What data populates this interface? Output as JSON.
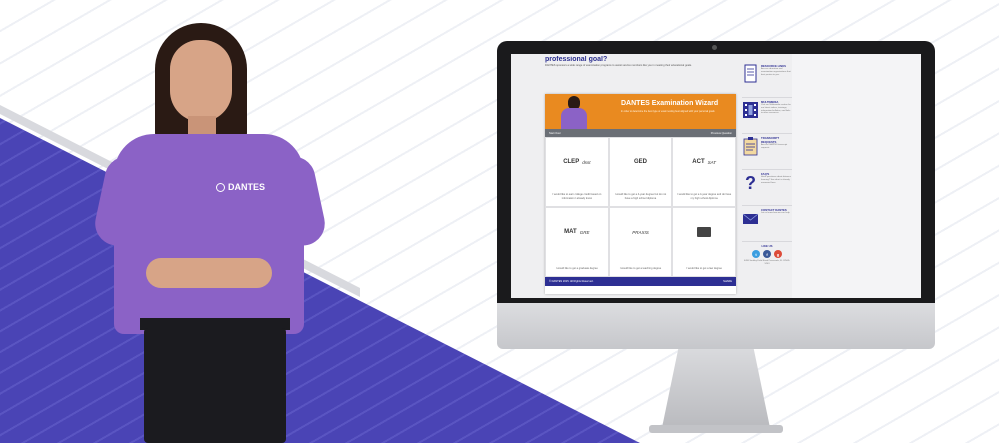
{
  "brand": {
    "shirt_logo": "DANTES"
  },
  "colors": {
    "purple": "#8b62c6",
    "band": "#4a44b5",
    "orange": "#e98a20",
    "navy": "#2d2f93"
  },
  "page": {
    "heading": "professional goal?",
    "subtext": "DANTES sponsors a wide range of examination programs to assist service members like you in meeting their educational goals."
  },
  "wizard": {
    "title": "DANTES Examination Wizard",
    "subtitle": "In order to determine the best type or exam testing best aligned with your personal goals",
    "nav_back": "Start Over",
    "nav_next": "Previous Question",
    "cells": [
      {
        "logos": [
          "CLEP",
          "dsst"
        ],
        "caption": "I would like to earn college credit based on information I already know"
      },
      {
        "logos": [
          "GED"
        ],
        "caption": "I would like to get a 4-year degree but do not have a high school diploma"
      },
      {
        "logos": [
          "ACT",
          "SAT"
        ],
        "caption": "I would like to get a 4-year degree and do have my high school diploma"
      },
      {
        "logos": [
          "MAT",
          "GRE"
        ],
        "caption": "I would like to get a graduate degree"
      },
      {
        "logos": [
          "PRAXIS"
        ],
        "caption": "I would like to get a teaching degree"
      },
      {
        "logos": [
          ""
        ],
        "caption": "I would like to get a law degree"
      }
    ],
    "footer_left": "© DANTES 2015. All Rights Reserved.",
    "footer_right": "SHARE"
  },
  "sidebar": {
    "items": [
      {
        "icon": "document-icon",
        "title": "RESOURCE LINKS",
        "desc": "Access education and examination organizations that best pertain to you."
      },
      {
        "icon": "film-icon",
        "title": "MULTIMEDIA",
        "desc": "Visit our Multimedia section for our latest videos, trainings, information bulletins, and links to other resources."
      },
      {
        "icon": "clipboard-icon",
        "title": "TRANSCRIPT REQUESTS",
        "desc": "Access DANTES transcript requests"
      },
      {
        "icon": "question-icon",
        "title": "FAQ'S",
        "desc": "Have questions about distance learning? See what is already answered here."
      },
      {
        "icon": "envelope-icon",
        "title": "CONTACT DANTES",
        "desc": "Let us know how we can help"
      }
    ],
    "like_us": "LIKE US",
    "address": "6490 Saufley Field Road Pensacola, FL 32509-5243"
  }
}
